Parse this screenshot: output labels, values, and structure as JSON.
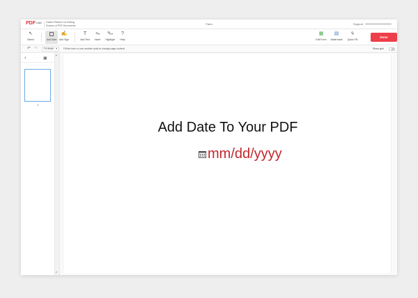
{
  "header": {
    "logo_main": "PDF",
    "logo_sub": "Liner",
    "tagline_line1": "Online Platform for Editing",
    "tagline_line2": "Dozens of PDF Documents",
    "document_name": "Form",
    "support_label": "Support"
  },
  "toolbar": {
    "tools_left": [
      {
        "label": "Select"
      },
      {
        "label": "Add Date"
      },
      {
        "label": "Add Sign"
      },
      {
        "label": "Add Text"
      },
      {
        "label": "Insert"
      },
      {
        "label": "Highlight"
      },
      {
        "label": "Help"
      }
    ],
    "tools_right": [
      {
        "label": "Edit Form"
      },
      {
        "label": "Watermark"
      },
      {
        "label": "Quick Fill"
      }
    ],
    "done_label": "Done",
    "done_color": "#ee3e49"
  },
  "subbar": {
    "zoom_value": "Fit Width",
    "hint": "Fill the form or use another tools to change page content",
    "show_grid_label": "Show grid"
  },
  "sidebar": {
    "page_number": "1"
  },
  "document": {
    "heading": "Add Date To Your PDF",
    "date_placeholder": "mm/dd/yyyy",
    "date_color": "#c1272d"
  },
  "icons": [
    "cursor-icon",
    "calendar-icon",
    "signature-icon",
    "text-icon",
    "plus-icon",
    "highlighter-icon",
    "help-icon",
    "form-icon",
    "watermark-icon",
    "lightning-icon",
    "undo-icon",
    "redo-icon",
    "chevron-left-icon",
    "thumbnail-icon"
  ]
}
